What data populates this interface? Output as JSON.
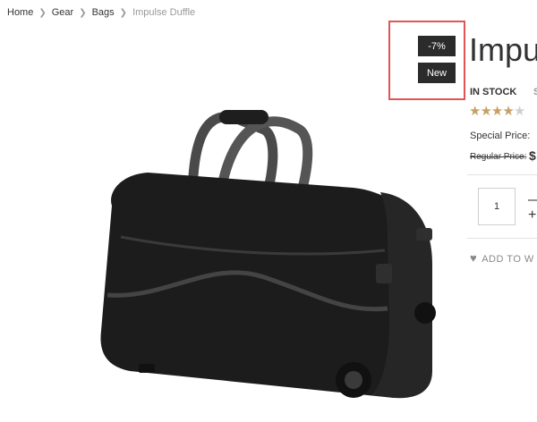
{
  "breadcrumb": {
    "items": [
      "Home",
      "Gear",
      "Bags"
    ],
    "current": "Impulse Duffle"
  },
  "badges": {
    "discount": "-7%",
    "new": "New"
  },
  "product": {
    "title": "Impu",
    "stock": "IN STOCK",
    "sku_fragment": "S",
    "rating": 4,
    "rating_max": 5,
    "special_price_label": "Special Price:",
    "regular_price_label": "Regular Price:",
    "regular_price_fragment": "$",
    "quantity": "1",
    "wishlist_label": "ADD TO W"
  },
  "colors": {
    "highlight": "#e05555",
    "badge_bg": "#2b2b2b",
    "star_on": "#c9a063"
  },
  "icons": [
    "chevron-right-icon",
    "heart-icon",
    "star-icon",
    "minus-icon",
    "plus-icon"
  ]
}
